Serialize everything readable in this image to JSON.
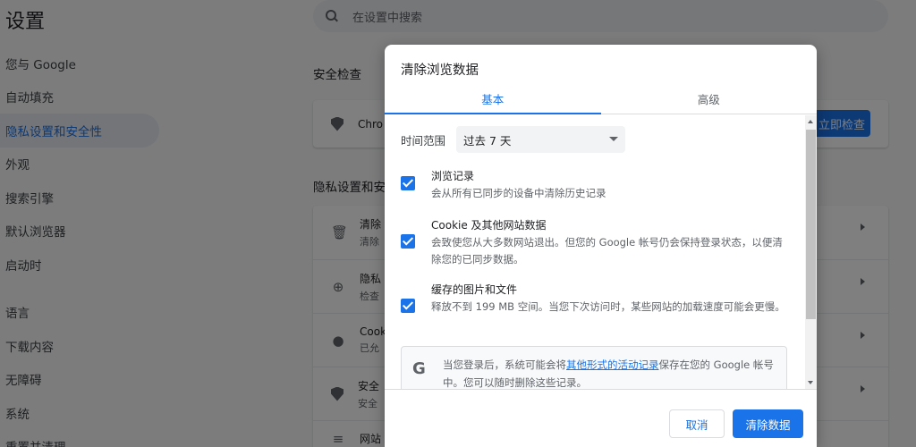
{
  "page": {
    "title": "设置"
  },
  "search": {
    "placeholder": "在设置中搜索"
  },
  "nav": {
    "items": [
      {
        "label": "您与 Google"
      },
      {
        "label": "自动填充"
      },
      {
        "label": "隐私设置和安全性",
        "active": true
      },
      {
        "label": "外观"
      },
      {
        "label": "搜索引擎"
      },
      {
        "label": "默认浏览器"
      },
      {
        "label": "启动时"
      },
      {
        "label": "语言"
      },
      {
        "label": "下载内容"
      },
      {
        "label": "无障碍"
      },
      {
        "label": "系统"
      },
      {
        "label": "重置并清理"
      }
    ]
  },
  "safety_check": {
    "section_title": "安全检查",
    "text": "Chro",
    "button": "立即检查"
  },
  "privacy": {
    "section_title": "隐私设置和安全性",
    "rows": [
      {
        "icon": "trash-icon",
        "title": "清除",
        "subtitle": "清除"
      },
      {
        "icon": "compass-icon",
        "title": "隐私",
        "subtitle": "检查"
      },
      {
        "icon": "cookie-icon",
        "title": "Cook",
        "subtitle": "已允"
      },
      {
        "icon": "shield-icon",
        "title": "安全",
        "subtitle": "安全"
      },
      {
        "icon": "site-settings-icon",
        "title": "网站",
        "subtitle": ""
      }
    ]
  },
  "dialog": {
    "title": "清除浏览数据",
    "tabs": [
      {
        "label": "基本",
        "active": true
      },
      {
        "label": "高级"
      }
    ],
    "time_range": {
      "label": "时间范围",
      "value": "过去 7 天"
    },
    "options": [
      {
        "title": "浏览记录",
        "desc": "会从所有已同步的设备中清除历史记录",
        "checked": true
      },
      {
        "title": "Cookie 及其他网站数据",
        "desc": "会致使您从大多数网站退出。但您的 Google 帐号仍会保持登录状态，以便清除您的已同步数据。",
        "checked": true
      },
      {
        "title": "缓存的图片和文件",
        "desc": "释放不到 199 MB 空间。当您下次访问时，某些网站的加载速度可能会更慢。",
        "checked": true
      }
    ],
    "notice": {
      "icon": "google-g-icon",
      "text_before": "当您登录后，系统可能会将",
      "link": "其他形式的活动记录",
      "text_after": "保存在您的 Google 帐号中。您可以随时删除这些记录。"
    },
    "cancel_label": "取消",
    "clear_label": "清除数据"
  },
  "colors": {
    "accent": "#1a73e8",
    "overlay": "rgba(0,0,0,0.5)"
  }
}
